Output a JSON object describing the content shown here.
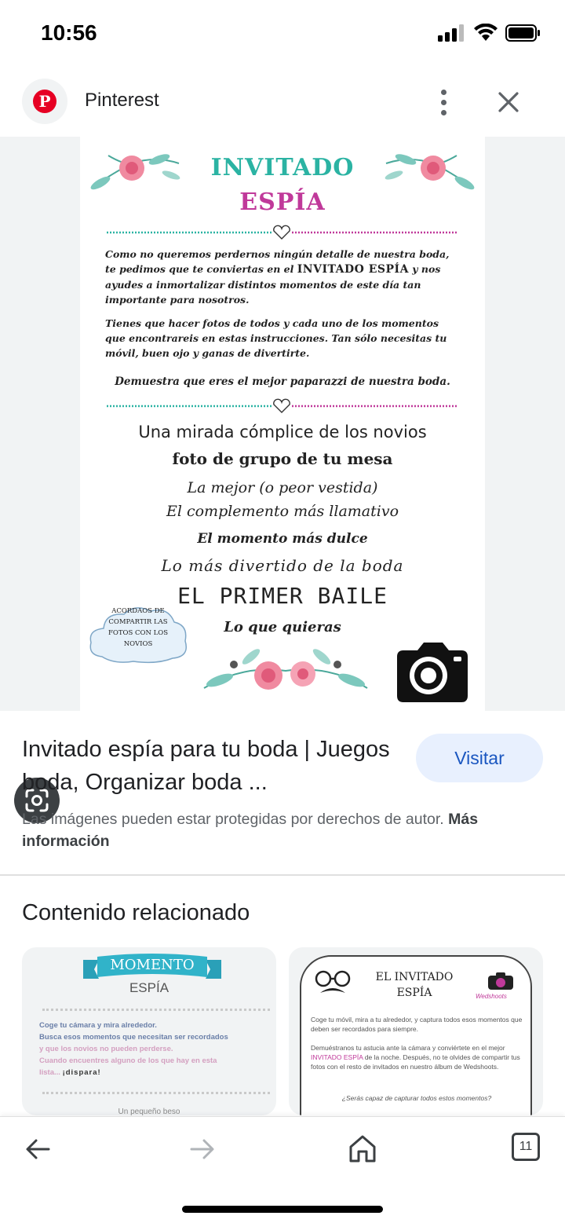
{
  "status": {
    "time": "10:56"
  },
  "header": {
    "site_name": "Pinterest"
  },
  "poster": {
    "title_line1": "INVITADO",
    "title_line2": "ESPÍA",
    "para1_a": "Como no queremos perdernos ningún detalle de nuestra boda, te pedimos que te conviertas en el ",
    "para1_em": "INVITADO ESPÍA",
    "para1_b": " y nos ayudes a inmortalizar distintos momentos de este día tan importante para nosotros.",
    "para2": "Tienes que hacer fotos de todos y cada uno de los momentos que encontrareis en estas instrucciones. Tan sólo necesitas tu móvil, buen ojo y ganas de divertirte.",
    "cta": "Demuestra que eres el mejor paparazzi de nuestra boda.",
    "moments": [
      "Una mirada cómplice de los novios",
      "foto de grupo de tu mesa",
      "La mejor (o peor vestida)",
      "El complemento más llamativo",
      "El momento más dulce",
      "Lo más divertido de la boda",
      "EL PRIMER BAILE",
      "Lo que quieras"
    ],
    "cloud_text": "ACORDAOS DE COMPARTIR LAS FOTOS CON LOS NOVIOS"
  },
  "info": {
    "title": "Invitado espía para tu boda | Juegos boda, Organizar boda ...",
    "visit_label": "Visitar",
    "copyright": "Las imágenes pueden estar protegidas por derechos de autor.",
    "more_info": "Más información"
  },
  "related": {
    "title": "Contenido relacionado",
    "card1": {
      "banner": "MOMENTO",
      "sub": "ESPÍA",
      "line1": "Coge tu cámara y mira alrededor.",
      "line2": "Busca esos momentos que necesitan ser recordados",
      "line3": "y que los novios no pueden perderse.",
      "line4": "Cuando encuentres alguno de los que hay en esta",
      "line5_a": "lista... ",
      "line5_b": "¡dispara!",
      "foot": "Un pequeño beso"
    },
    "card2": {
      "title_line1": "EL INVITADO",
      "title_line2": "ESPÍA",
      "label": "Wedshoots",
      "p1": "Coge tu móvil, mira a tu alrededor, y captura todos esos momentos que deben ser recordados para siempre.",
      "p2_a": "Demuéstranos tu astucia ante la cámara y conviértete en el mejor ",
      "p2_em": "INVITADO ESPÍA",
      "p2_b": " de la noche. Después, no te olvides de compartir tus fotos con el resto de invitados en nuestro álbum de Wedshoots.",
      "p3": "¿Serás capaz de capturar todos estos momentos?"
    }
  },
  "bottom_nav": {
    "tabs_count": "11"
  },
  "colors": {
    "accent": "#1a56c0",
    "visit_bg": "#e8f0fe",
    "pinterest": "#e60023",
    "teal": "#2bb3a3",
    "magenta": "#c0399a"
  }
}
